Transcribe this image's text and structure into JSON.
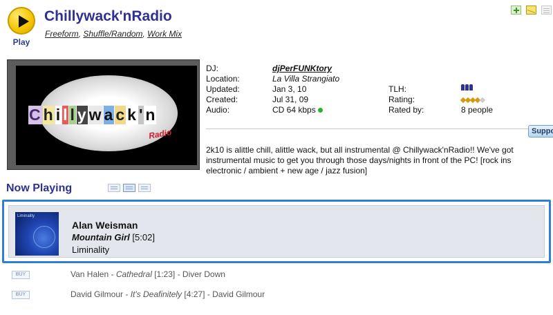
{
  "header": {
    "play_label": "Play",
    "station_name": "Chillywack'nRadio",
    "tags": [
      "Freeform",
      "Shuffle/Random",
      "Work Mix"
    ]
  },
  "icons": {
    "play": "play-icon",
    "add": "add-icon",
    "mail": "mail-icon",
    "calendar": "calendar-icon",
    "tlh": "people-icon",
    "rating": "stars-icon"
  },
  "logo": {
    "letters": [
      "C",
      "h",
      "i",
      "l",
      "l",
      "y",
      "w",
      "a",
      "c",
      "k",
      "'",
      "n"
    ],
    "subtext": "Radio"
  },
  "meta": {
    "dj_label": "DJ:",
    "dj_value": "djPerFUNKtory",
    "location_label": "Location:",
    "location_value": "La Villa Strangiato",
    "updated_label": "Updated:",
    "updated_value": "Jan 3, 10",
    "created_label": "Created:",
    "created_value": "Jul 31, 09",
    "audio_label": "Audio:",
    "audio_value": "CD 64 kbps",
    "tlh_label": "TLH:",
    "rating_label": "Rating:",
    "rating_stars": 4,
    "rated_by_label": "Rated by:",
    "rated_by_value": "8 people"
  },
  "support_button": "Support",
  "description": {
    "line1": "2k10 is alittle chill, alittle wack, but all instrumental @ Chillywack'nRadio!! We've got",
    "line2": "instrumental music to get you through those days/nights in front of the PC! [rock ins",
    "line3": "electronic / ambient + new age / jazz fusion]"
  },
  "now_playing": {
    "heading": "Now Playing",
    "artist": "Alan Weisman",
    "song": "Mountain Girl",
    "duration": "[5:02]",
    "album": "Liminality",
    "art_label": "Liminality"
  },
  "history": [
    {
      "buy": "BUY",
      "artist": "Van Halen",
      "song": "Cathedral",
      "duration": "[1:23]",
      "album": "Diver Down"
    },
    {
      "buy": "BUY",
      "artist": "David Gilmour",
      "song": "It's Deafinitely",
      "duration": "[4:27]",
      "album": "David Gilmour"
    }
  ],
  "colors": {
    "brand": "#2e3190",
    "highlight_border": "#2f7fd8",
    "now_playing_bg": "#e4e6ed",
    "audio_indicator": "#2db12d"
  }
}
